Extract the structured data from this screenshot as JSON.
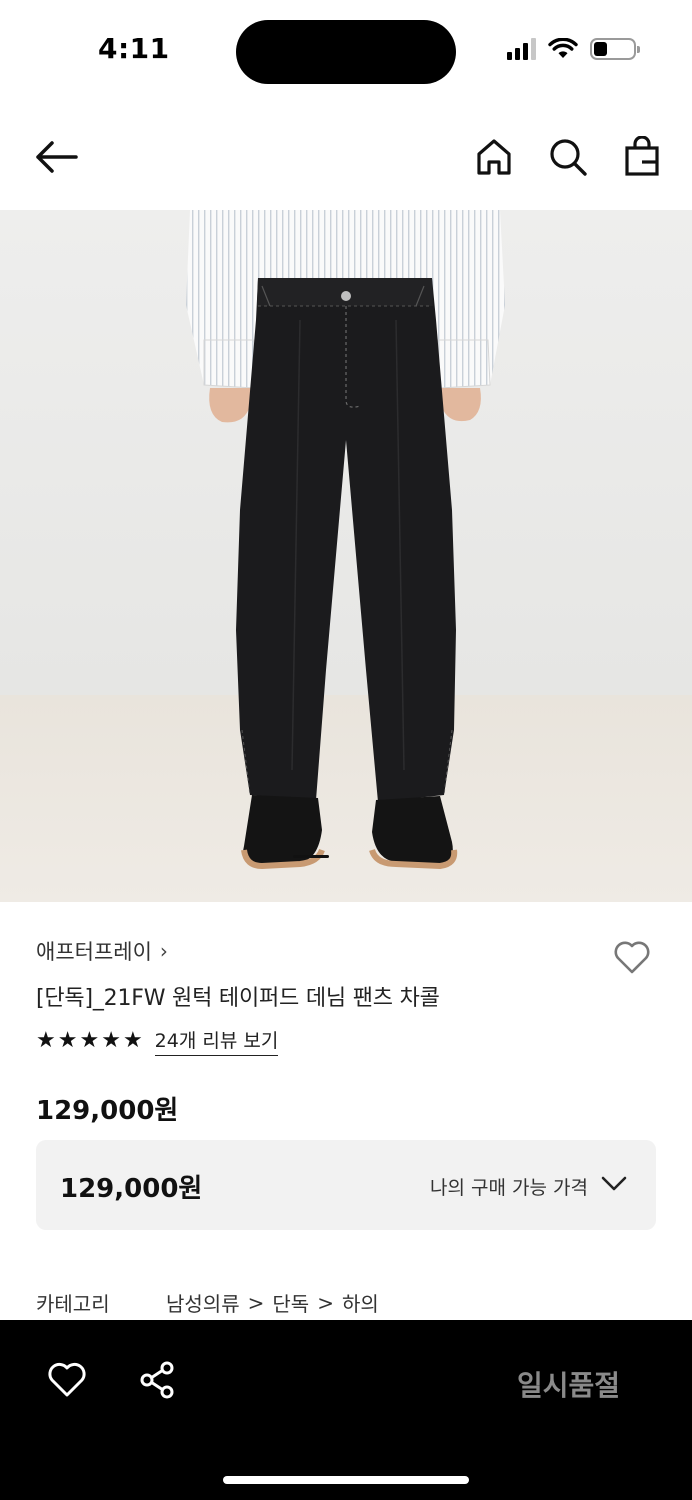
{
  "status_bar": {
    "time": "4:11",
    "battery_level": 0.35
  },
  "nav": {
    "icons": [
      "back-arrow-icon",
      "home-icon",
      "search-icon",
      "shopping-bag-icon"
    ]
  },
  "product": {
    "brand": "애프터프레이",
    "brand_chevron": "›",
    "title": "[단독]_21FW 원턱 테이퍼드 데님 팬츠 차콜",
    "rating_stars": 5,
    "review_link": "24개 리뷰 보기",
    "price": "129,000원",
    "benefit_price": "129,000원",
    "benefit_label": "나의 구매 가능 가격",
    "category_label": "카테고리",
    "category_path": [
      "남성의류",
      "단독",
      "하의"
    ]
  },
  "image": {
    "slide_index": 1
  },
  "bottom_bar": {
    "soldout_label": "일시품절",
    "icons": [
      "heart-icon",
      "share-icon"
    ]
  },
  "colors": {
    "accent": "#000000",
    "price_box_bg": "#f2f2f2",
    "disabled_text": "#8a8a8a"
  }
}
